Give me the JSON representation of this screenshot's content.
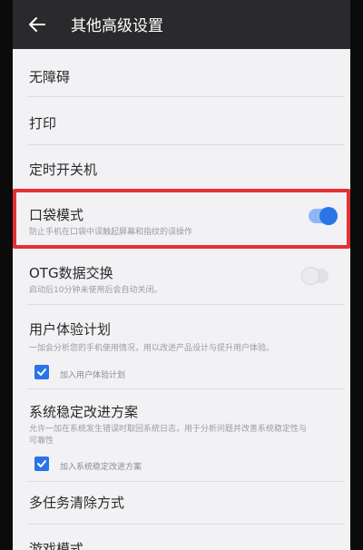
{
  "header": {
    "title": "其他高级设置",
    "back_icon": "back-arrow-icon"
  },
  "items": [
    {
      "label": "无障碍"
    },
    {
      "label": "打印"
    },
    {
      "label": "定时开关机"
    },
    {
      "label": "口袋模式",
      "sub": "防止手机在口袋中误触起屏幕和指纹的误操作",
      "toggle_on": true
    },
    {
      "label": "OTG数据交换",
      "sub": "启动后10分钟未使用后会自动关闭。",
      "toggle_on": false
    },
    {
      "label": "用户体验计划",
      "sub": "一加会分析您的手机使用情况，用以改进产品设计与提升用户体验。",
      "checkbox_label": "加入用户体验计划",
      "checked": true
    },
    {
      "label": "系统稳定改进方案",
      "sub": "允许一加在系统发生错误时取回系统日志，用于分析问题并改善系统稳定性与",
      "sub2": "可靠性",
      "checkbox_label": "加入系统稳定改进方案",
      "checked": true
    },
    {
      "label": "多任务清除方式"
    },
    {
      "label": "游戏模式"
    }
  ],
  "colors": {
    "accent": "#2a74e8",
    "highlight": "#e53034",
    "header_bg": "#2a2a2d",
    "page_bg": "#f2f1f4"
  }
}
